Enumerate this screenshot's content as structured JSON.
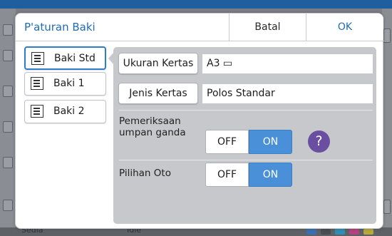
{
  "dialog": {
    "title": "P'aturan Baki",
    "cancel_label": "Batal",
    "ok_label": "OK"
  },
  "trays": [
    {
      "label": "Baki Std",
      "icon": "tray-icon",
      "selected": true
    },
    {
      "label": "Baki 1",
      "icon": "tray-icon",
      "selected": false
    },
    {
      "label": "Baki 2",
      "icon": "tray-icon",
      "selected": false
    }
  ],
  "settings": {
    "paper_size": {
      "button_label": "Ukuran Kertas",
      "value": "A3 ▭"
    },
    "paper_type": {
      "button_label": "Jenis Kertas",
      "value": "Polos Standar"
    },
    "double_feed": {
      "label_line1": "Pemeriksaan",
      "label_line2": "umpan ganda",
      "off_label": "OFF",
      "on_label": "ON",
      "state": "ON",
      "help_icon": "?"
    },
    "auto_select": {
      "label": "Pilihan Oto",
      "off_label": "OFF",
      "on_label": "ON",
      "state": "ON"
    }
  },
  "background": {
    "status_left": "Sedia",
    "status_mid": "Idle"
  },
  "colors": {
    "accent": "#1f6cb4",
    "toggle_on": "#4a90d9",
    "help": "#6a4fa0",
    "panel": "#c6c8cb"
  }
}
